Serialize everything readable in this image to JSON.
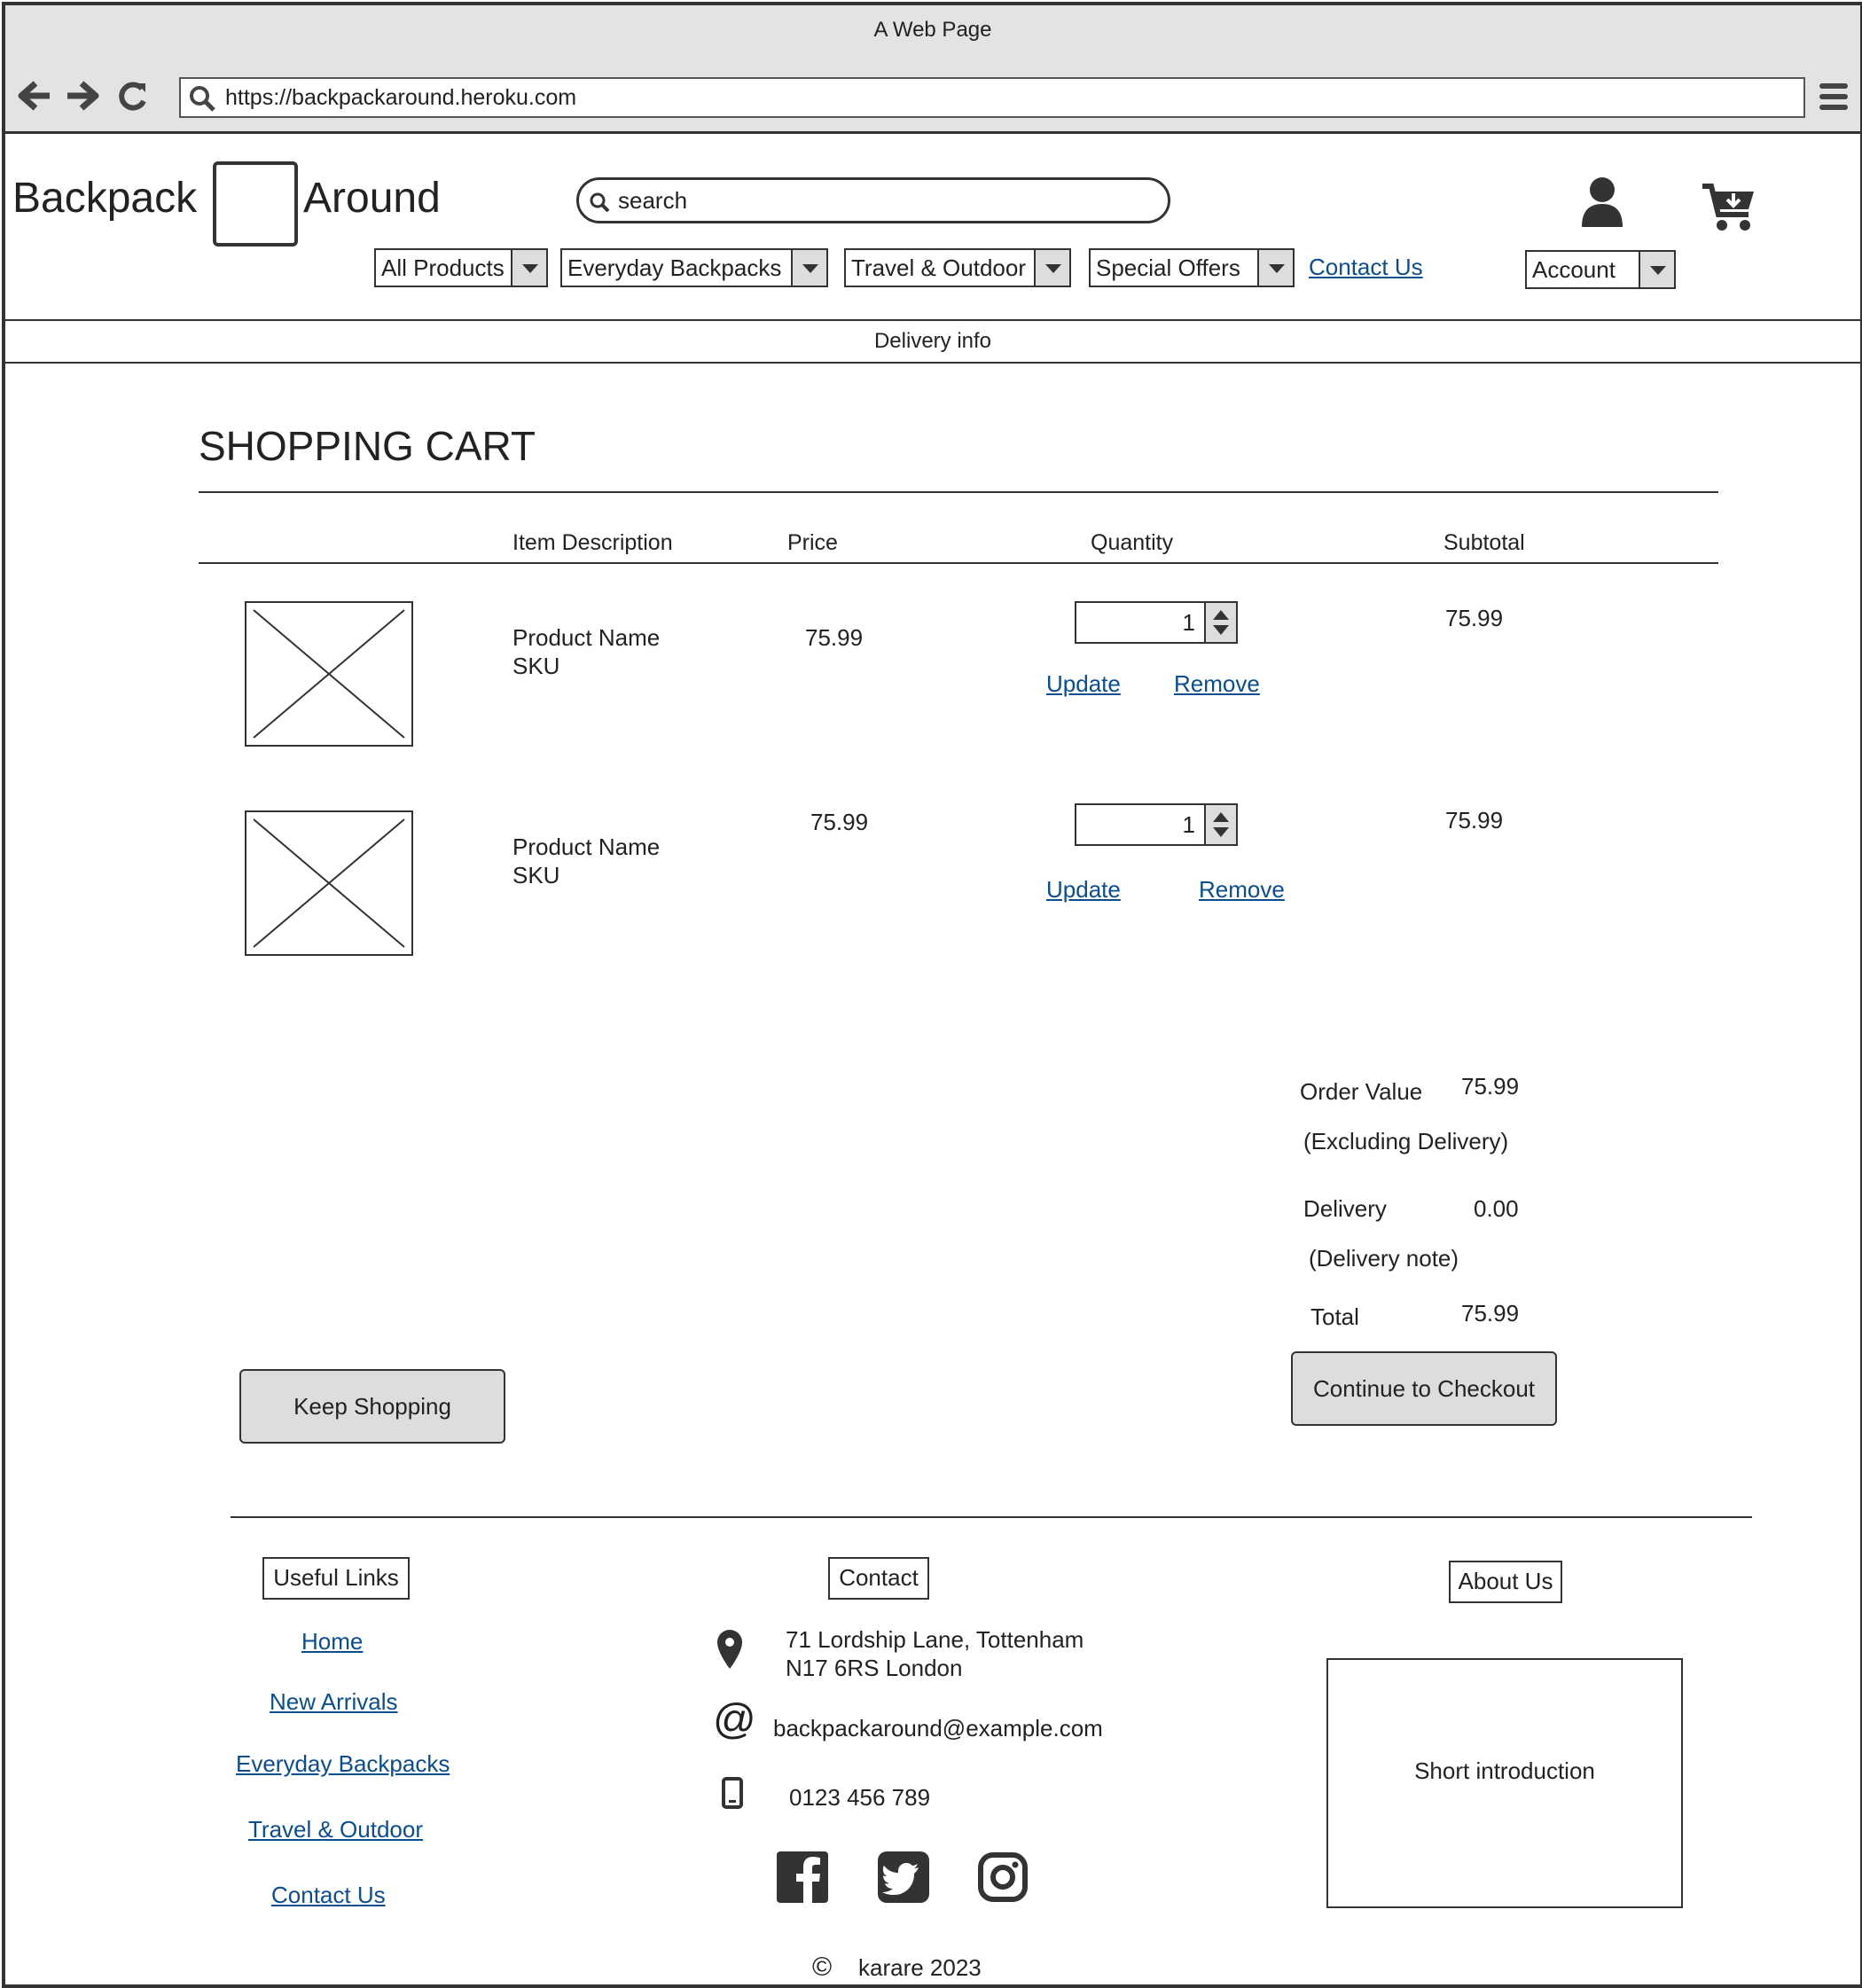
{
  "browser": {
    "title": "A Web Page",
    "url": "https://backpackaround.heroku.com"
  },
  "header": {
    "logo_left": "Backpack",
    "logo_right": "Around",
    "search_placeholder": "search",
    "nav": [
      "All Products",
      "Everyday Backpacks",
      "Travel & Outdoor",
      "Special Offers"
    ],
    "contact_link": "Contact Us",
    "account_label": "Account",
    "delivery_banner": "Delivery info"
  },
  "cart": {
    "title": "SHOPPING CART",
    "columns": {
      "description": "Item Description",
      "price": "Price",
      "quantity": "Quantity",
      "subtotal": "Subtotal"
    },
    "items": [
      {
        "name": "Product Name",
        "sku": "SKU",
        "price": "75.99",
        "quantity": "1",
        "subtotal": "75.99",
        "update": "Update",
        "remove": "Remove"
      },
      {
        "name": "Product Name",
        "sku": "SKU",
        "price": "75.99",
        "quantity": "1",
        "subtotal": "75.99",
        "update": "Update",
        "remove": "Remove"
      }
    ],
    "summary": {
      "order_value_label": "Order Value",
      "order_value": "75.99",
      "excluding_delivery": "(Excluding Delivery)",
      "delivery_label": "Delivery",
      "delivery_value": "0.00",
      "delivery_note": "(Delivery note)",
      "total_label": "Total",
      "total_value": "75.99"
    },
    "keep_shopping": "Keep Shopping",
    "checkout": "Continue to Checkout"
  },
  "footer": {
    "useful_links_title": "Useful Links",
    "links": [
      "Home",
      "New Arrivals",
      "Everyday Backpacks",
      "Travel & Outdoor",
      "Contact Us"
    ],
    "contact_title": "Contact",
    "address_line1": "71 Lordship Lane, Tottenham",
    "address_line2": "N17 6RS London",
    "email": "backpackaround@example.com",
    "phone": "0123 456 789",
    "about_title": "About Us",
    "about_text": "Short introduction",
    "copyright": "karare 2023"
  }
}
